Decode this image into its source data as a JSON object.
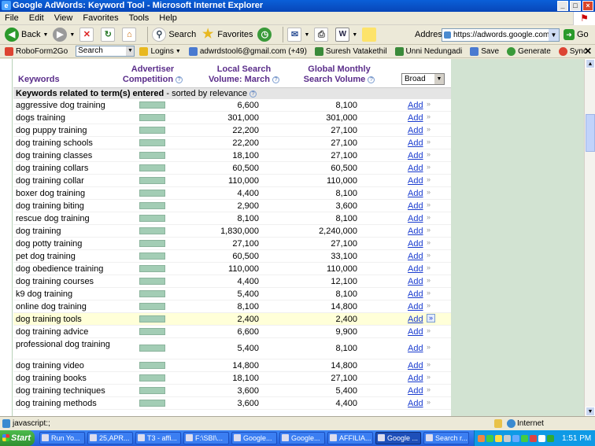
{
  "window": {
    "title": "Google AdWords: Keyword Tool - Microsoft Internet Explorer"
  },
  "menu": [
    "File",
    "Edit",
    "View",
    "Favorites",
    "Tools",
    "Help"
  ],
  "toolbar": {
    "back": "Back",
    "search": "Search",
    "favorites": "Favorites"
  },
  "address": {
    "label": "Address",
    "url": "https://adwords.google.com/select/",
    "go": "Go"
  },
  "linksbar": {
    "roboform": "RoboForm2Go",
    "search_value": "Search",
    "logins": "Logins",
    "email": "adwrdstool6@gmail.com (+49)",
    "person1": "Suresh Vatakethil",
    "person2": "Unni Nedungadi",
    "save": "Save",
    "generate": "Generate",
    "sync": "Sync"
  },
  "table": {
    "headers": {
      "keywords": "Keywords",
      "competition_1": "Advertiser",
      "competition_2": "Competition",
      "local_1": "Local Search",
      "local_2": "Volume: March",
      "global_1": "Global Monthly",
      "global_2": "Search Volume",
      "match": "Broad"
    },
    "section_bold": "Keywords related to term(s) entered",
    "section_rest": "- sorted by relevance",
    "add_label": "Add",
    "rows": [
      {
        "kw": "aggressive dog training",
        "local": "6,600",
        "global": "8,100"
      },
      {
        "kw": "dogs training",
        "local": "301,000",
        "global": "301,000"
      },
      {
        "kw": "dog puppy training",
        "local": "22,200",
        "global": "27,100"
      },
      {
        "kw": "dog training schools",
        "local": "22,200",
        "global": "27,100"
      },
      {
        "kw": "dog training classes",
        "local": "18,100",
        "global": "27,100"
      },
      {
        "kw": "dog training collars",
        "local": "60,500",
        "global": "60,500"
      },
      {
        "kw": "dog training collar",
        "local": "110,000",
        "global": "110,000"
      },
      {
        "kw": "boxer dog training",
        "local": "4,400",
        "global": "8,100"
      },
      {
        "kw": "dog training biting",
        "local": "2,900",
        "global": "3,600"
      },
      {
        "kw": "rescue dog training",
        "local": "8,100",
        "global": "8,100"
      },
      {
        "kw": "dog training",
        "local": "1,830,000",
        "global": "2,240,000"
      },
      {
        "kw": "dog potty training",
        "local": "27,100",
        "global": "27,100"
      },
      {
        "kw": "pet dog training",
        "local": "60,500",
        "global": "33,100"
      },
      {
        "kw": "dog obedience training",
        "local": "110,000",
        "global": "110,000"
      },
      {
        "kw": "dog training courses",
        "local": "4,400",
        "global": "12,100"
      },
      {
        "kw": "k9 dog training",
        "local": "5,400",
        "global": "8,100"
      },
      {
        "kw": "online dog training",
        "local": "8,100",
        "global": "14,800"
      },
      {
        "kw": "dog training tools",
        "local": "2,400",
        "global": "2,400",
        "highlight": true
      },
      {
        "kw": "dog training advice",
        "local": "6,600",
        "global": "9,900"
      },
      {
        "kw": "professional dog training",
        "local": "5,400",
        "global": "8,100",
        "tall": true
      },
      {
        "kw": "dog training video",
        "local": "14,800",
        "global": "14,800"
      },
      {
        "kw": "dog training books",
        "local": "18,100",
        "global": "27,100"
      },
      {
        "kw": "dog training techniques",
        "local": "3,600",
        "global": "5,400"
      },
      {
        "kw": "dog training methods",
        "local": "3,600",
        "global": "4,400"
      }
    ]
  },
  "status": {
    "text": "javascript:;",
    "zone": "Internet"
  },
  "taskbar": {
    "start": "Start",
    "tasks": [
      "Run Yo...",
      "25,APR...",
      "T3 - affi...",
      "F:\\SBI\\...",
      "Google...",
      "Google...",
      "AFFILIA...",
      "Google ...",
      "Search r..."
    ],
    "active_index": 7,
    "clock": "1:51 PM"
  }
}
